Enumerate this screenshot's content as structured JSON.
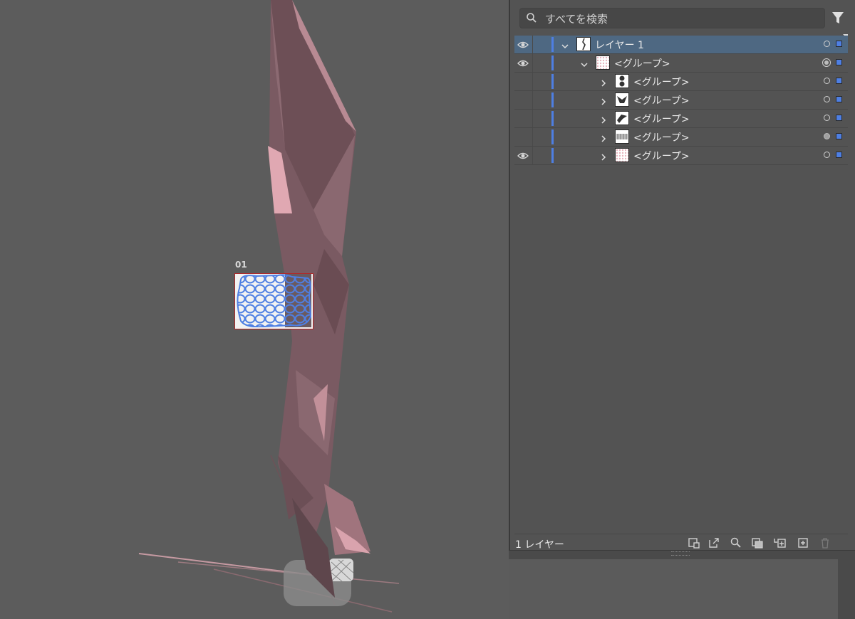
{
  "canvas": {
    "artboard_label": "01",
    "art_color": "#7a5a62",
    "art_highlight": "#d9a3ad",
    "selection_color": "#4e7fe3"
  },
  "layers_panel": {
    "search_placeholder": "すべてを検索",
    "icons": {
      "search": "search-icon",
      "filter": "filter-icon"
    },
    "accent_color": "#4e7fe3",
    "rows": [
      {
        "label": "レイヤー 1",
        "level": 0,
        "visible": true,
        "expanded": true,
        "selected": true,
        "target": "empty"
      },
      {
        "label": "<グループ>",
        "level": 1,
        "visible": true,
        "expanded": true,
        "selected": false,
        "target": "double"
      },
      {
        "label": "<グループ>",
        "level": 2,
        "visible": false,
        "expanded": false,
        "selected": false,
        "target": "empty"
      },
      {
        "label": "<グループ>",
        "level": 2,
        "visible": false,
        "expanded": false,
        "selected": false,
        "target": "empty"
      },
      {
        "label": "<グループ>",
        "level": 2,
        "visible": false,
        "expanded": false,
        "selected": false,
        "target": "empty"
      },
      {
        "label": "<グループ>",
        "level": 2,
        "visible": false,
        "expanded": false,
        "selected": false,
        "target": "filled"
      },
      {
        "label": "<グループ>",
        "level": 2,
        "visible": true,
        "expanded": false,
        "selected": false,
        "target": "empty"
      }
    ],
    "footer": {
      "layer_count": "1 レイヤー",
      "buttons": [
        "collect-for-export-icon",
        "export-icon",
        "locate-object-icon",
        "make-clipping-mask-icon",
        "create-sublayer-icon",
        "new-layer-icon",
        "delete-icon"
      ]
    }
  }
}
